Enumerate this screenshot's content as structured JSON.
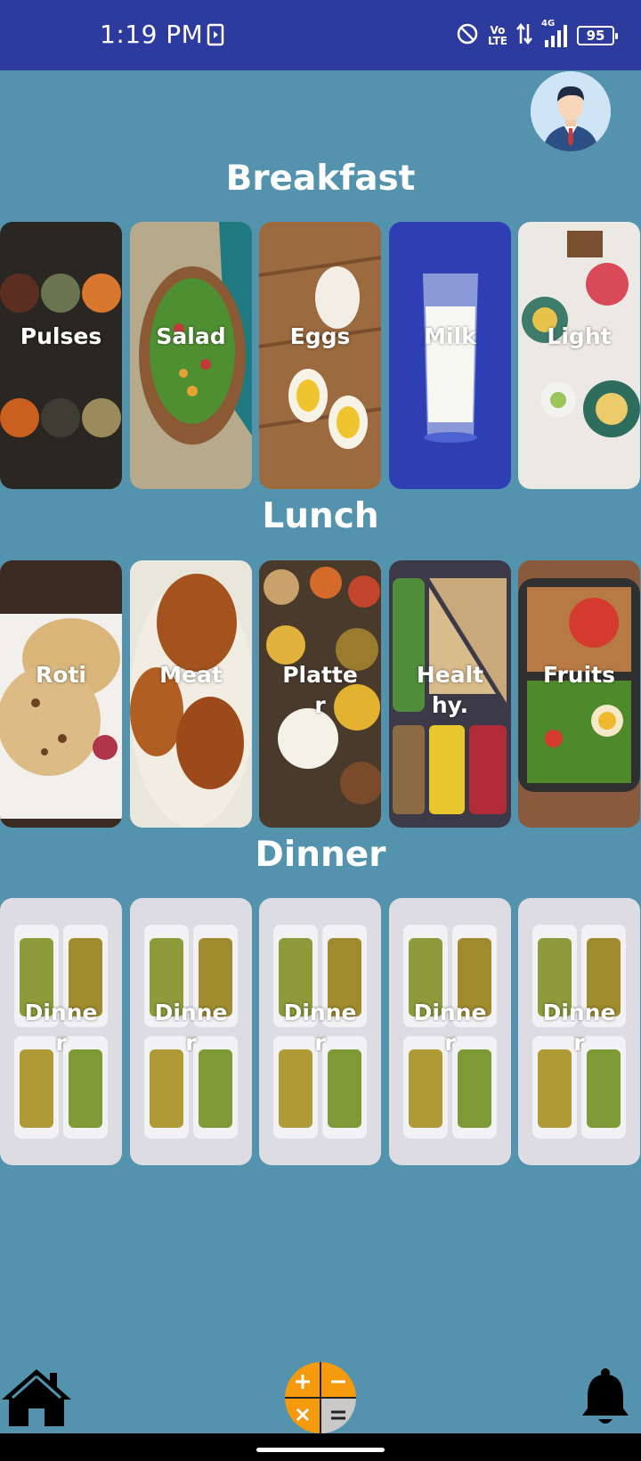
{
  "status_bar": {
    "time": "1:19 PM",
    "network_top": "Vo",
    "network_bottom": "LTE",
    "signal_label": "4G",
    "battery": "95",
    "icons": [
      "document-icon",
      "do-not-disturb-icon",
      "volte-icon",
      "data-arrows-icon",
      "signal-icon",
      "battery-icon"
    ]
  },
  "header": {
    "avatar_icon": "user-avatar-icon"
  },
  "sections": {
    "breakfast": {
      "title": "Breakfast",
      "cards": [
        {
          "label": "Pulses"
        },
        {
          "label": "Salad"
        },
        {
          "label": "Eggs"
        },
        {
          "label": "Milk"
        },
        {
          "label": "Light"
        }
      ]
    },
    "lunch": {
      "title": "Lunch",
      "cards": [
        {
          "label": "Roti"
        },
        {
          "label": "Meat"
        },
        {
          "label": "Platter"
        },
        {
          "label": "Healthy."
        },
        {
          "label": "Fruits"
        }
      ]
    },
    "dinner": {
      "title": "Dinner",
      "cards": [
        {
          "label": "Dinner"
        },
        {
          "label": "Dinner"
        },
        {
          "label": "Dinner"
        },
        {
          "label": "Dinner"
        },
        {
          "label": "Dinner"
        }
      ]
    }
  },
  "bottom_nav": {
    "home_icon": "home-icon",
    "calculator_icon": "calculator-icon",
    "notifications_icon": "bell-icon",
    "calculator_colors": {
      "orange": "#F59A0C",
      "gray": "#C9C9C9"
    }
  },
  "colors": {
    "background": "#5393AD",
    "status_bar": "#2E3B9E",
    "text": "#FFFFFF"
  }
}
